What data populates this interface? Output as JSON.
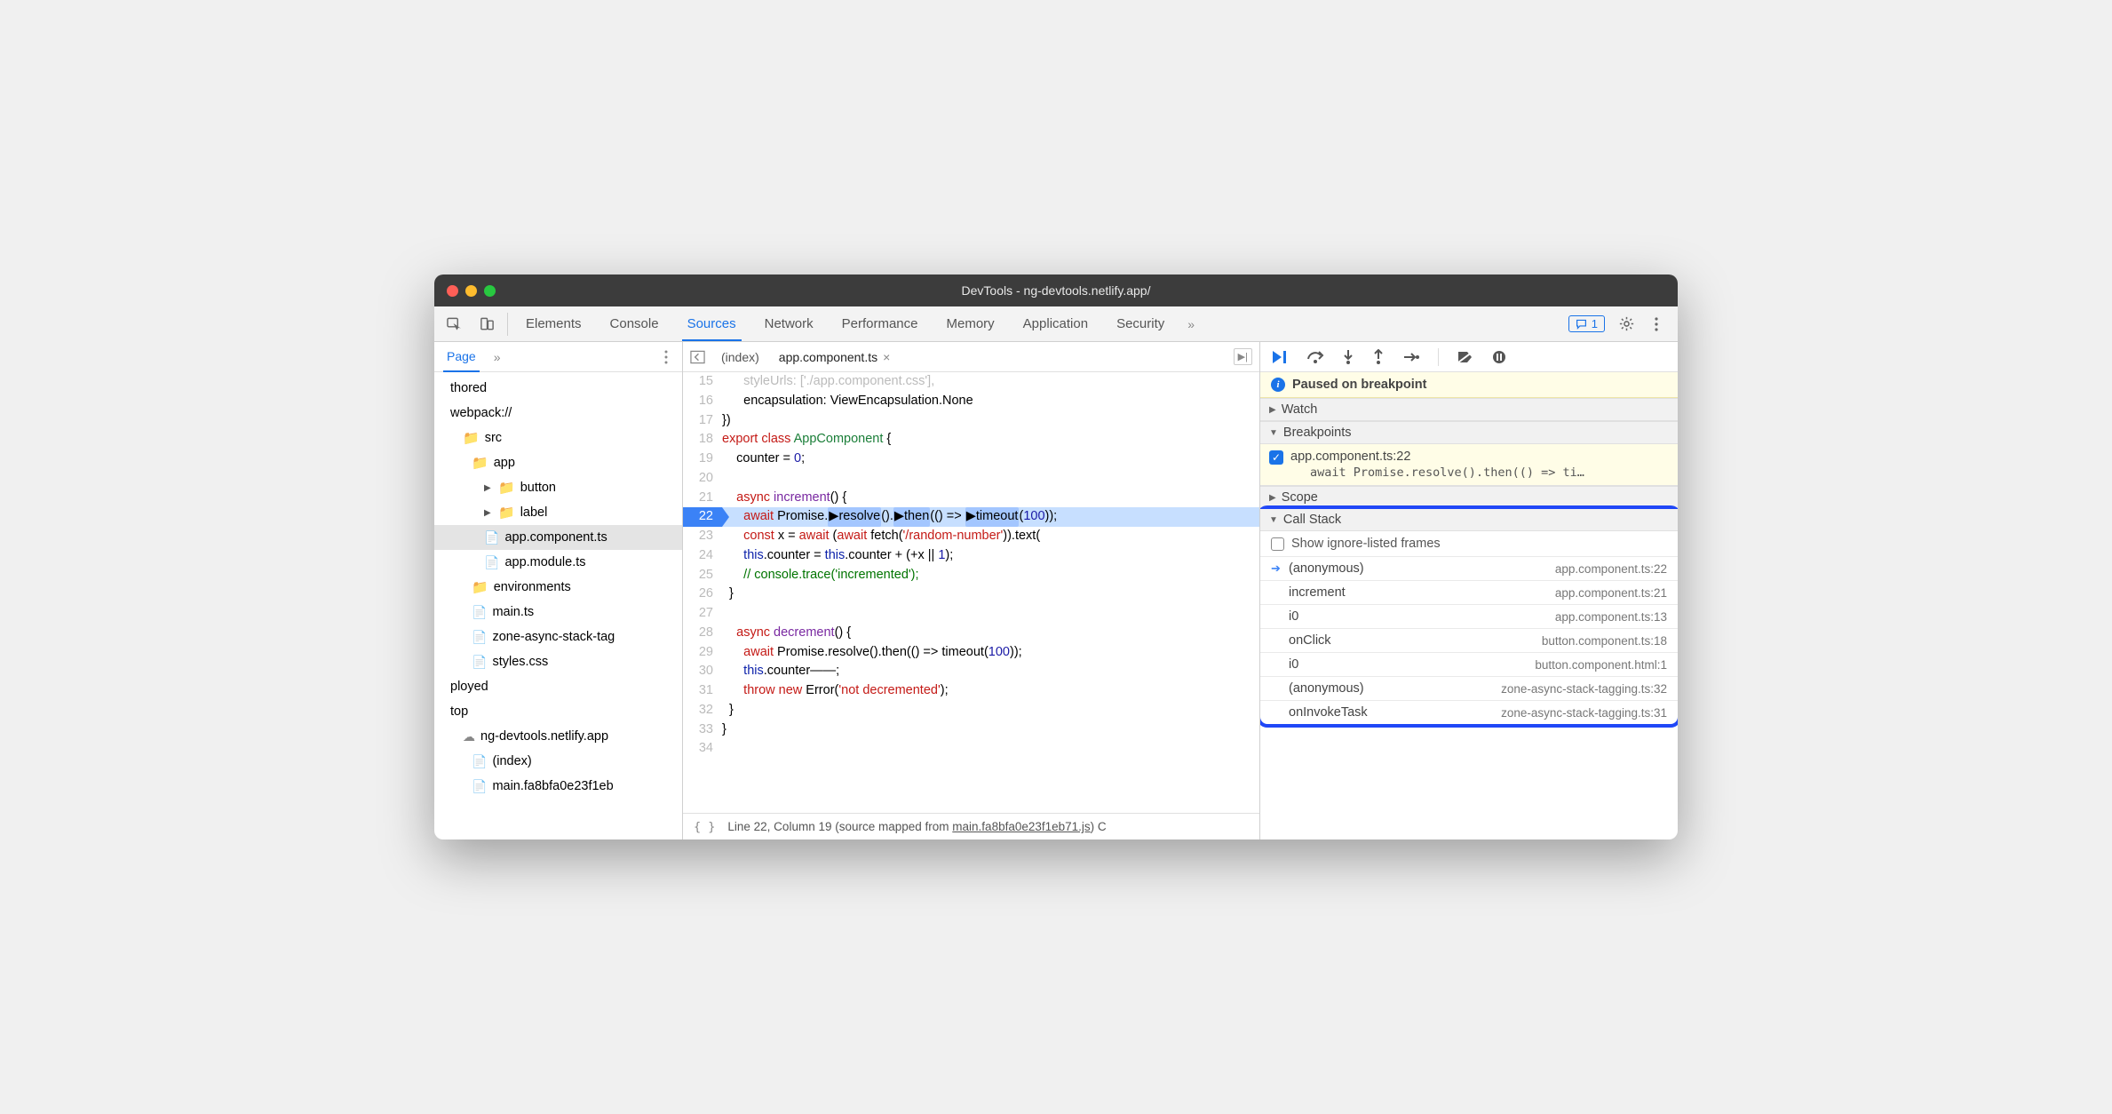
{
  "window_title": "DevTools - ng-devtools.netlify.app/",
  "main_tabs": [
    "Elements",
    "Console",
    "Sources",
    "Network",
    "Performance",
    "Memory",
    "Application",
    "Security"
  ],
  "main_tab_active": "Sources",
  "message_count": "1",
  "left": {
    "tab": "Page",
    "tree": {
      "authored": "thored",
      "webpack": "webpack://",
      "src": "src",
      "app": "app",
      "button": "button",
      "label": "label",
      "appcomp": "app.component.ts",
      "appmod": "app.module.ts",
      "envs": "environments",
      "main": "main.ts",
      "zone": "zone-async-stack-tag",
      "styles": "styles.css",
      "deployed": "ployed",
      "top": "top",
      "domain": "ng-devtools.netlify.app",
      "index": "(index)",
      "mainhash": "main.fa8bfa0e23f1eb"
    }
  },
  "editor": {
    "tab_index": "(index)",
    "tab_active": "app.component.ts",
    "status_line": "Line 22, Column 19",
    "status_mapped": "(source mapped from ",
    "status_file": "main.fa8bfa0e23f1eb71.js",
    "status_end": ") C"
  },
  "code": {
    "l15": "      styleUrls: ['./app.component.css'],",
    "l16": "      encapsulation: ViewEncapsulation.None",
    "l17": "})",
    "l18_a": "export",
    "l18_b": "class",
    "l18_c": "AppComponent",
    "l18_d": " {",
    "l19_a": "counter = ",
    "l19_b": "0",
    "l19_c": ";",
    "l21_a": "async",
    "l21_b": "increment",
    "l21_c": "() {",
    "l22_a": "await",
    "l22_b": "Promise.",
    "l22_c": "resolve",
    "l22_d": "().",
    "l22_e": "then",
    "l22_f": "(() => ",
    "l22_g": "timeout",
    "l22_h": "(",
    "l22_i": "100",
    "l22_j": "));",
    "l23_a": "const",
    "l23_b": " x = ",
    "l23_c": "await",
    "l23_d": " (",
    "l23_e": "await",
    "l23_f": " fetch(",
    "l23_g": "'/random-number'",
    "l23_h": ")).text(",
    "l24_a": "this",
    "l24_b": ".counter = ",
    "l24_c": "this",
    "l24_d": ".counter + (+x || ",
    "l24_e": "1",
    "l24_f": ");",
    "l25": "// console.trace('incremented');",
    "l26": "  }",
    "l28_a": "async",
    "l28_b": "decrement",
    "l28_c": "() {",
    "l29_a": "await",
    "l29_b": " Promise.resolve().then(() => timeout(",
    "l29_c": "100",
    "l29_d": "));",
    "l30_a": "this",
    "l30_b": ".counter——;",
    "l31_a": "throw",
    "l31_b": "new",
    "l31_c": " Error(",
    "l31_d": "'not decremented'",
    "l31_e": ");",
    "l32": "  }",
    "l33": "}"
  },
  "debugger": {
    "paused_msg": "Paused on breakpoint",
    "watch": "Watch",
    "breakpoints": "Breakpoints",
    "bp_title": "app.component.ts:22",
    "bp_code": "await Promise.resolve().then(() => ti…",
    "scope": "Scope",
    "callstack": "Call Stack",
    "ignore_label": "Show ignore-listed frames",
    "stack": [
      {
        "name": "(anonymous)",
        "loc": "app.component.ts:22",
        "current": true
      },
      {
        "name": "increment",
        "loc": "app.component.ts:21",
        "current": false
      },
      {
        "name": "i0",
        "loc": "app.component.ts:13",
        "current": false
      },
      {
        "name": "onClick",
        "loc": "button.component.ts:18",
        "current": false
      },
      {
        "name": "i0",
        "loc": "button.component.html:1",
        "current": false
      },
      {
        "name": "(anonymous)",
        "loc": "zone-async-stack-tagging.ts:32",
        "current": false
      },
      {
        "name": "onInvokeTask",
        "loc": "zone-async-stack-tagging.ts:31",
        "current": false
      }
    ]
  }
}
